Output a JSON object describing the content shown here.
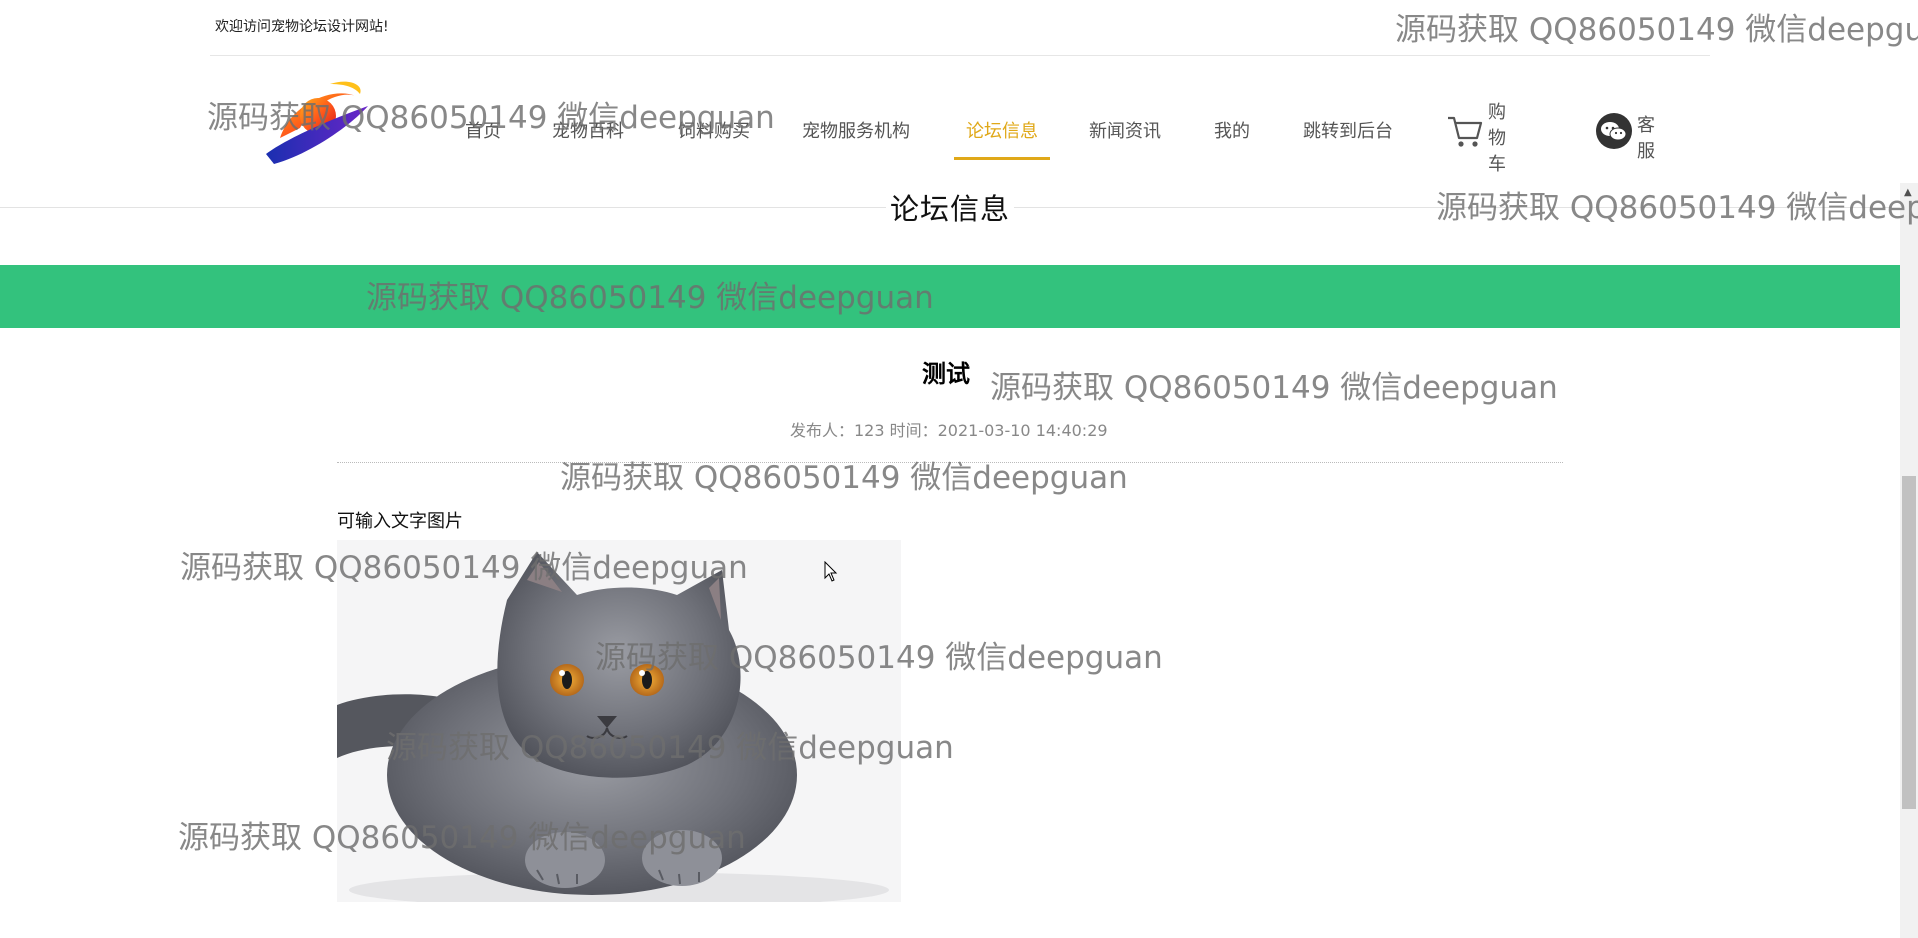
{
  "topbar": {
    "welcome": "欢迎访问宠物论坛设计网站!"
  },
  "nav": {
    "items": [
      "首页",
      "宠物百科",
      "饲料购买",
      "宠物服务机构",
      "论坛信息",
      "新闻资讯",
      "我的",
      "跳转到后台"
    ],
    "active_index": 4,
    "cart_label": "购物车",
    "service_label": "客服"
  },
  "section": {
    "title": "论坛信息"
  },
  "post": {
    "title": "测试",
    "meta": "发布人：123 时间：2021-03-10 14:40:29",
    "body": "可输入文字图片"
  },
  "watermark": {
    "text": "源码获取 QQ86050149 微信deepguan"
  },
  "colors": {
    "banner": "#33c27d",
    "active": "#e0a818"
  }
}
